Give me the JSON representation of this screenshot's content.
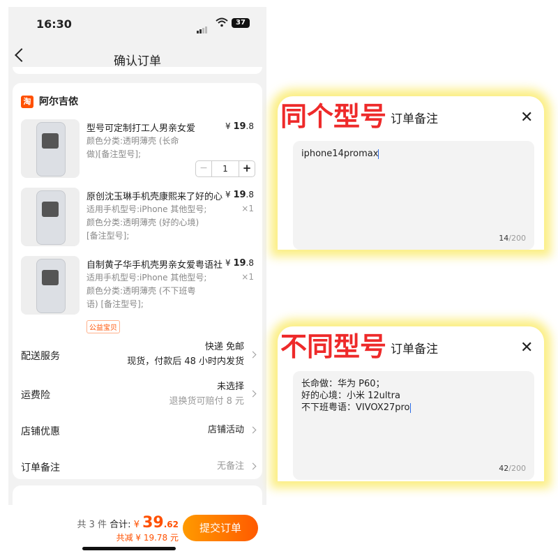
{
  "status": {
    "time": "16:30",
    "battery": "37"
  },
  "nav": {
    "title": "确认订单"
  },
  "shop": {
    "icon_text": "淘",
    "name": "阿尔吉侬"
  },
  "items": [
    {
      "title": "型号可定制打工人男亲女爱",
      "desc": "颜色分类:透明薄壳 (长命\n做)[备注型号];",
      "price_sym": "¥",
      "price_int": "19",
      "price_dec": ".8",
      "qty": "1"
    },
    {
      "title": "原创沈玉琳手机壳康熙来了好的心",
      "desc": "适用手机型号:iPhone 其他型号;\n颜色分类:透明薄壳 (好的心境)\n[备注型号];",
      "price_sym": "¥",
      "price_int": "19",
      "price_dec": ".8",
      "qty": "×1"
    },
    {
      "title": "自制黄子华手机壳男亲女爱粤语社",
      "desc": "适用手机型号:iPhone 其他型号;\n颜色分类:透明薄壳 (不下班粤\n语) [备注型号];",
      "price_sym": "¥",
      "price_int": "19",
      "price_dec": ".8",
      "qty": "×1",
      "tag": "公益宝贝"
    }
  ],
  "rows": {
    "delivery": {
      "label": "配送服务",
      "line1": "快递 免邮",
      "line2": "现货，付款后 48 小时内发货"
    },
    "insurance": {
      "label": "运费险",
      "line1": "未选择",
      "line2": "退换货可赔付 8 元"
    },
    "discount": {
      "label": "店铺优惠",
      "value": "店铺活动"
    },
    "note": {
      "label": "订单备注",
      "value": "无备注"
    }
  },
  "footer": {
    "count": "共 3 件",
    "total_label": "合计:",
    "currency": "¥",
    "total_int": "39",
    "total_dec": ".62",
    "saved": "共减 ¥ 19.78 元",
    "submit": "提交订单"
  },
  "panel1": {
    "annotation": "同个型号",
    "title": "订单备注",
    "text": "iphone14promax",
    "count": "14",
    "max": "/200"
  },
  "panel2": {
    "annotation": "不同型号",
    "title": "订单备注",
    "text": "长命做：华为 P60；\n好的心境：小米 12ultra\n不下班粤语：VIVOX27pro",
    "count": "42",
    "max": "/200"
  },
  "colors": {
    "accent": "#ff5000",
    "highlight": "#fae85a",
    "annotation": "#ee2a2a"
  }
}
